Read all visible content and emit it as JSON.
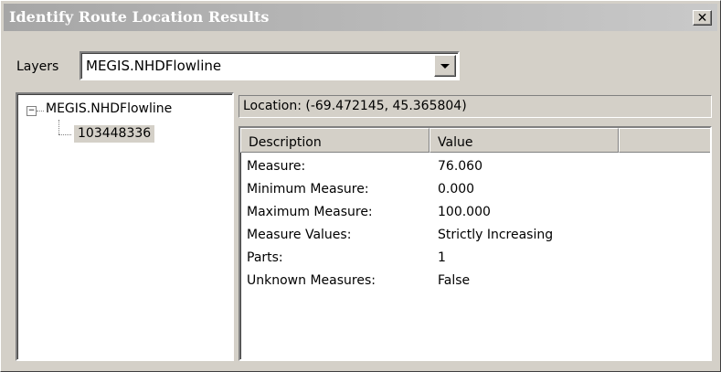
{
  "window": {
    "title": "Identify Route Location Results",
    "close_glyph": "✕"
  },
  "layers": {
    "label": "Layers",
    "selected": "MEGIS.NHDFlowline"
  },
  "tree": {
    "expander_glyph": "−",
    "root_label": "MEGIS.NHDFlowline",
    "child_label": "103448336"
  },
  "location": {
    "text": "Location: (-69.472145, 45.365804)"
  },
  "table": {
    "columns": [
      "Description",
      "Value",
      ""
    ],
    "rows": [
      {
        "description": "Measure:",
        "value": "76.060"
      },
      {
        "description": "Minimum Measure:",
        "value": "0.000"
      },
      {
        "description": "Maximum Measure:",
        "value": "100.000"
      },
      {
        "description": "Measure Values:",
        "value": "Strictly Increasing"
      },
      {
        "description": "Parts:",
        "value": "1"
      },
      {
        "description": "Unknown Measures:",
        "value": "False"
      }
    ]
  },
  "icons": {
    "close": "close-icon",
    "dropdown": "chevron-down-icon",
    "expander": "collapse-icon"
  },
  "colors": {
    "dialog_face": "#d4d0c8",
    "title_gradient_start": "#a6a6a6",
    "title_gradient_end": "#c9c9c9",
    "selection": "#d4d0c8"
  }
}
